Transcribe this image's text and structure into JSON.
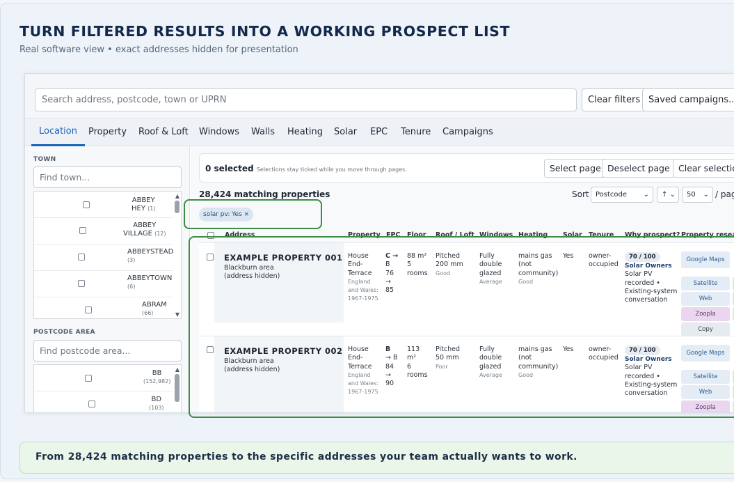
{
  "headline": "TURN FILTERED RESULTS INTO A WORKING PROSPECT LIST",
  "subheadline": "Real software view • exact addresses hidden for presentation",
  "toolbar": {
    "search_placeholder": "Search address, postcode, town or UPRN",
    "clear_filters": "Clear filters",
    "saved_campaigns": "Saved campaigns..."
  },
  "tabs": [
    "Location",
    "Property",
    "Roof & Loft",
    "Windows",
    "Walls",
    "Heating",
    "Solar",
    "EPC",
    "Tenure",
    "Campaigns"
  ],
  "active_tab": "Location",
  "sidebar": {
    "town_label": "TOWN",
    "town_placeholder": "Find town...",
    "towns": [
      {
        "name1": "ABBEY",
        "name2": "HEY",
        "count": "(1)"
      },
      {
        "name1": "ABBEY",
        "name2": "VILLAGE",
        "count": "(12)"
      },
      {
        "name1": "ABBEYSTEAD",
        "name2": "",
        "count": "(3)"
      },
      {
        "name1": "ABBEYTOWN",
        "name2": "",
        "count": "(6)"
      },
      {
        "name1": "ABRAM",
        "name2": "",
        "count": "(66)"
      }
    ],
    "postcode_label": "POSTCODE AREA",
    "postcode_placeholder": "Find postcode area...",
    "postcodes": [
      {
        "name": "BB",
        "count": "(152,982)"
      },
      {
        "name": "BD",
        "count": "(103)"
      }
    ]
  },
  "selection": {
    "count": "0 selected",
    "note": "Selections stay ticked while you move through pages.",
    "select_page": "Select page",
    "deselect_page": "Deselect page",
    "clear_selection": "Clear selection"
  },
  "results": {
    "matching": "28,424 matching properties",
    "sort_label": "Sort",
    "sort_value": "Postcode",
    "direction": "↑",
    "page_size": "50",
    "per_page": "/ pag",
    "chip": "solar pv: Yes ×"
  },
  "columns": [
    "Address",
    "Property",
    "EPC",
    "Floor",
    "Roof / Loft",
    "Windows",
    "Heating",
    "Solar",
    "Tenure",
    "Why prospect?",
    "Property research"
  ],
  "rows": [
    {
      "title": "EXAMPLE PROPERTY 001",
      "area": "Blackburn area",
      "hidden": "(address hidden)",
      "prop1": "House",
      "prop2": "End-",
      "prop3": "Terrace",
      "prop_m1": "England",
      "prop_m2": "and Wales:",
      "prop_m3": "1967-1975",
      "epc1": "C →",
      "epc2": "B",
      "epc3": "76",
      "epc4": "→",
      "epc5": "85",
      "floor1": "88 m²",
      "floor2": "5",
      "floor3": "rooms",
      "roof1": "Pitched",
      "roof2": "200 mm",
      "roof_m": "Good",
      "win1": "Fully",
      "win2": "double",
      "win3": "glazed",
      "win_m": "Average",
      "heat1": "mains gas",
      "heat2": "(not",
      "heat3": "community)",
      "heat_m": "Good",
      "solar": "Yes",
      "tenure1": "owner-",
      "tenure2": "occupied",
      "score": "70 / 100",
      "segment": "Solar Owners",
      "why1": "Solar PV",
      "why2": "recorded •",
      "why3": "Existing-system",
      "why4": "conversation",
      "links": [
        "Google Maps",
        "Satellite",
        "Web",
        "Zoopla",
        "Copy"
      ]
    },
    {
      "title": "EXAMPLE PROPERTY 002",
      "area": "Blackburn area",
      "hidden": "(address hidden)",
      "prop1": "House",
      "prop2": "End-",
      "prop3": "Terrace",
      "prop_m1": "England",
      "prop_m2": "and Wales:",
      "prop_m3": "1967-1975",
      "epc1": "B",
      "epc2": "→ B",
      "epc3": "84",
      "epc4": "→",
      "epc5": "90",
      "floor1": "113",
      "floor2": "m²",
      "floor3": "6",
      "floor4": "rooms",
      "roof1": "Pitched",
      "roof2": "50 mm",
      "roof_m": "Poor",
      "win1": "Fully",
      "win2": "double",
      "win3": "glazed",
      "win_m": "Average",
      "heat1": "mains gas",
      "heat2": "(not",
      "heat3": "community)",
      "heat_m": "Good",
      "solar": "Yes",
      "tenure1": "owner-",
      "tenure2": "occupied",
      "score": "70 / 100",
      "segment": "Solar Owners",
      "why1": "Solar PV",
      "why2": "recorded •",
      "why3": "Existing-system",
      "why4": "conversation",
      "links": [
        "Google Maps",
        "Satellite",
        "Web",
        "Zoopla"
      ]
    }
  ],
  "banner": "From 28,424 matching properties to the specific addresses your team actually wants to work.",
  "colors": {
    "highlight": "#3d8c44",
    "accent": "#1b64b8",
    "headline": "#13294b"
  }
}
